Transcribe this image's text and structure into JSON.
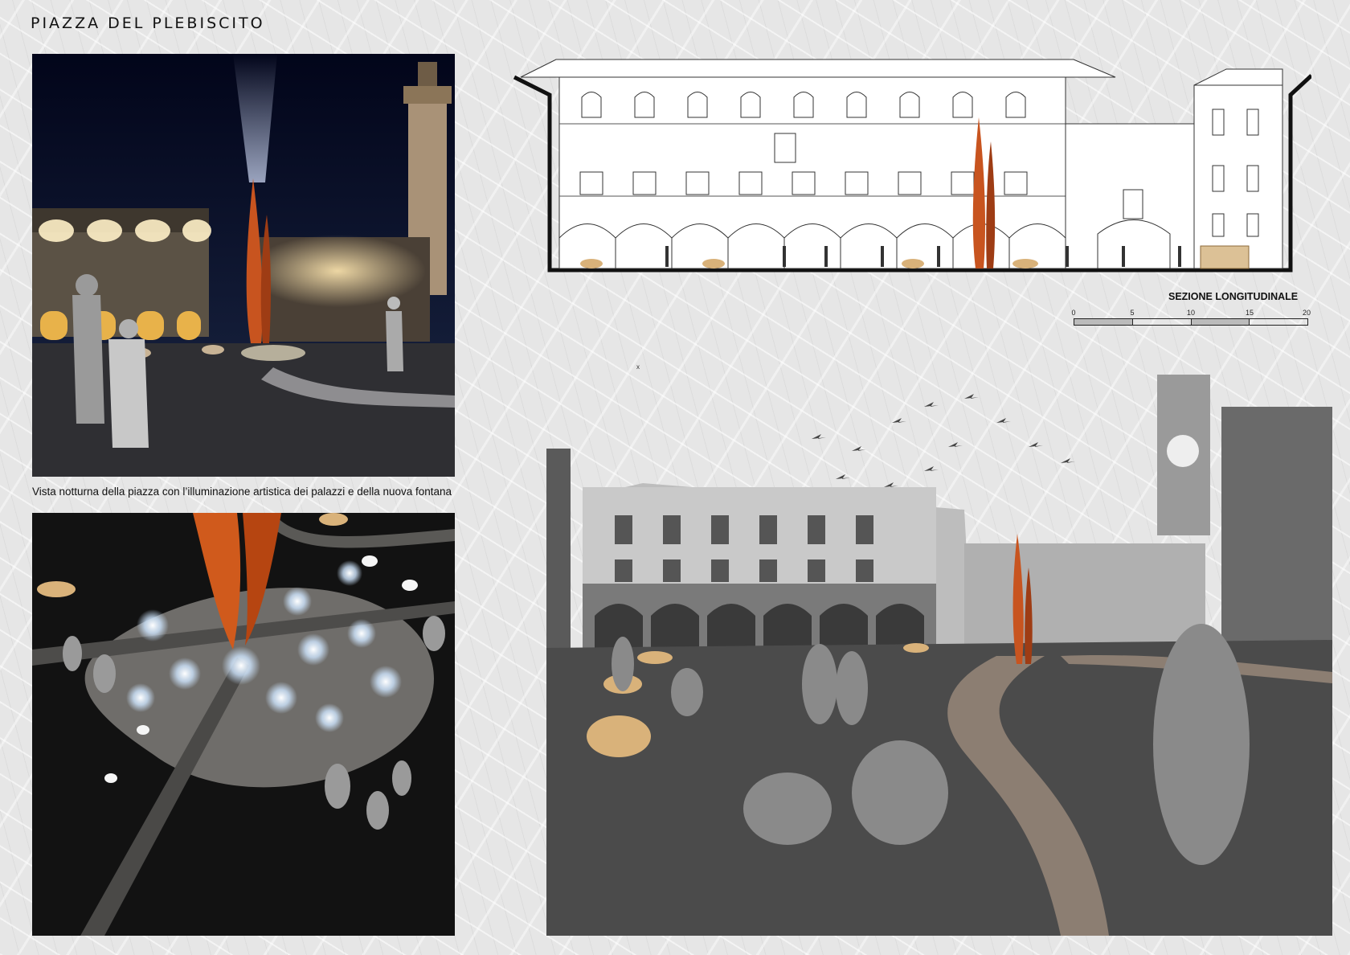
{
  "title": "PIAZZA DEL PLEBISCITO",
  "night_view": {
    "caption": "Vista notturna della piazza con l’illuminazione artistica dei palazzi e della nuova fontana"
  },
  "section": {
    "label": "SEZIONE LONGITUDINALE",
    "scale_ticks": [
      "0",
      "5",
      "10",
      "15",
      "20"
    ]
  },
  "marker": "x",
  "colors": {
    "corten": "#c8541f",
    "night_sky": "#050a1a",
    "paving": "#3a3a3a",
    "seat_wood": "#d9b27a"
  }
}
